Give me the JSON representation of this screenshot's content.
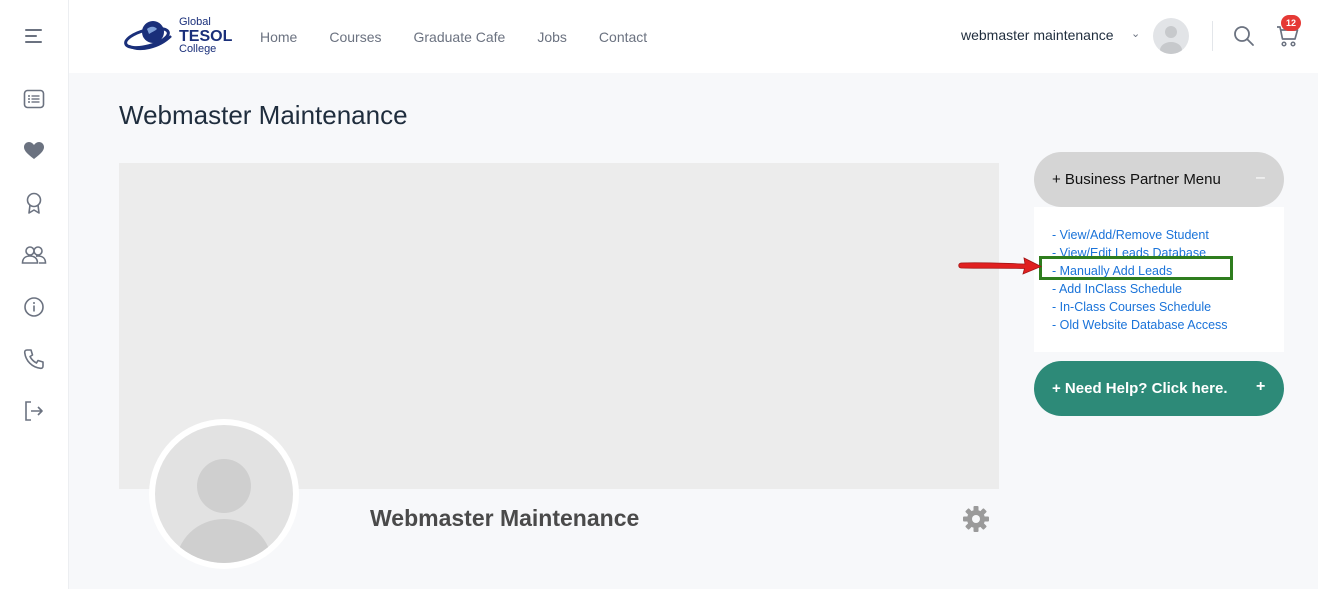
{
  "logo": {
    "line1": "Global",
    "line2": "TESOL",
    "line3": "College"
  },
  "nav": {
    "items": [
      "Home",
      "Courses",
      "Graduate Cafe",
      "Jobs",
      "Contact"
    ]
  },
  "user": {
    "name": "webmaster maintenance",
    "caret": "⌄"
  },
  "cart": {
    "count": "12"
  },
  "page": {
    "title": "Webmaster Maintenance"
  },
  "profile": {
    "name": "Webmaster Maintenance"
  },
  "business_menu": {
    "title": "+ Business Partner Menu",
    "collapse": "–",
    "items": [
      "- View/Add/Remove Student",
      "- View/Edit Leads Database",
      "- Manually Add Leads",
      "- Add InClass Schedule",
      "- In-Class Courses Schedule",
      "- Old Website Database Access"
    ]
  },
  "help": {
    "label": "+ Need Help? Click here.",
    "expand": "+"
  },
  "sidebar": {
    "icons": [
      "menu-icon",
      "list-icon",
      "heart-icon",
      "award-icon",
      "users-icon",
      "info-icon",
      "phone-icon",
      "logout-icon"
    ]
  },
  "colors": {
    "accent_teal": "#2d8a78",
    "link_blue": "#1a73d9",
    "highlight_green": "#2e7d1e",
    "arrow_red": "#e02020",
    "badge_red": "#e53935"
  }
}
